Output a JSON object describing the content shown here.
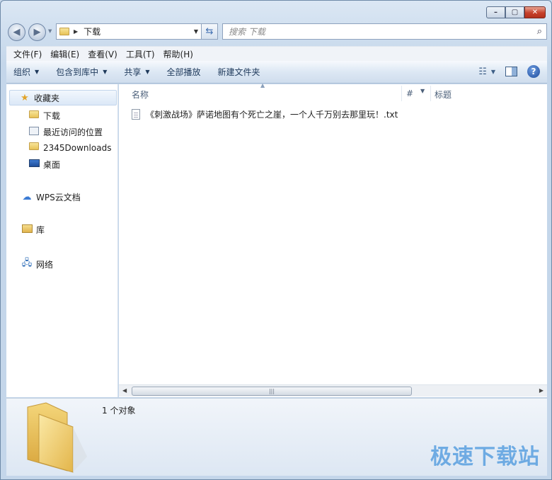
{
  "window": {
    "caption_min": "–",
    "caption_max": "▢",
    "caption_close": "✕"
  },
  "address": {
    "path": "下载",
    "search_placeholder": "搜索 下载"
  },
  "menubar": {
    "items": [
      "文件(F)",
      "编辑(E)",
      "查看(V)",
      "工具(T)",
      "帮助(H)"
    ]
  },
  "commandbar": {
    "organize": "组织",
    "include_library": "包含到库中",
    "share": "共享",
    "play_all": "全部播放",
    "new_folder": "新建文件夹"
  },
  "navpane": {
    "favorites": "收藏夹",
    "favorites_items": [
      "下载",
      "最近访问的位置",
      "2345Downloads",
      "桌面"
    ],
    "wps": "WPS云文档",
    "library": "库",
    "network": "网络"
  },
  "columns": {
    "name": "名称",
    "number": "#",
    "title": "标题"
  },
  "files": [
    {
      "name": "《刺激战场》萨诺地图有个死亡之崖，一个人千万别去那里玩！.txt"
    }
  ],
  "details": {
    "count": "1 个对象"
  },
  "watermark": "极速下载站",
  "colors": {
    "accent": "#5aa0e0",
    "close_button": "#c6402a"
  }
}
